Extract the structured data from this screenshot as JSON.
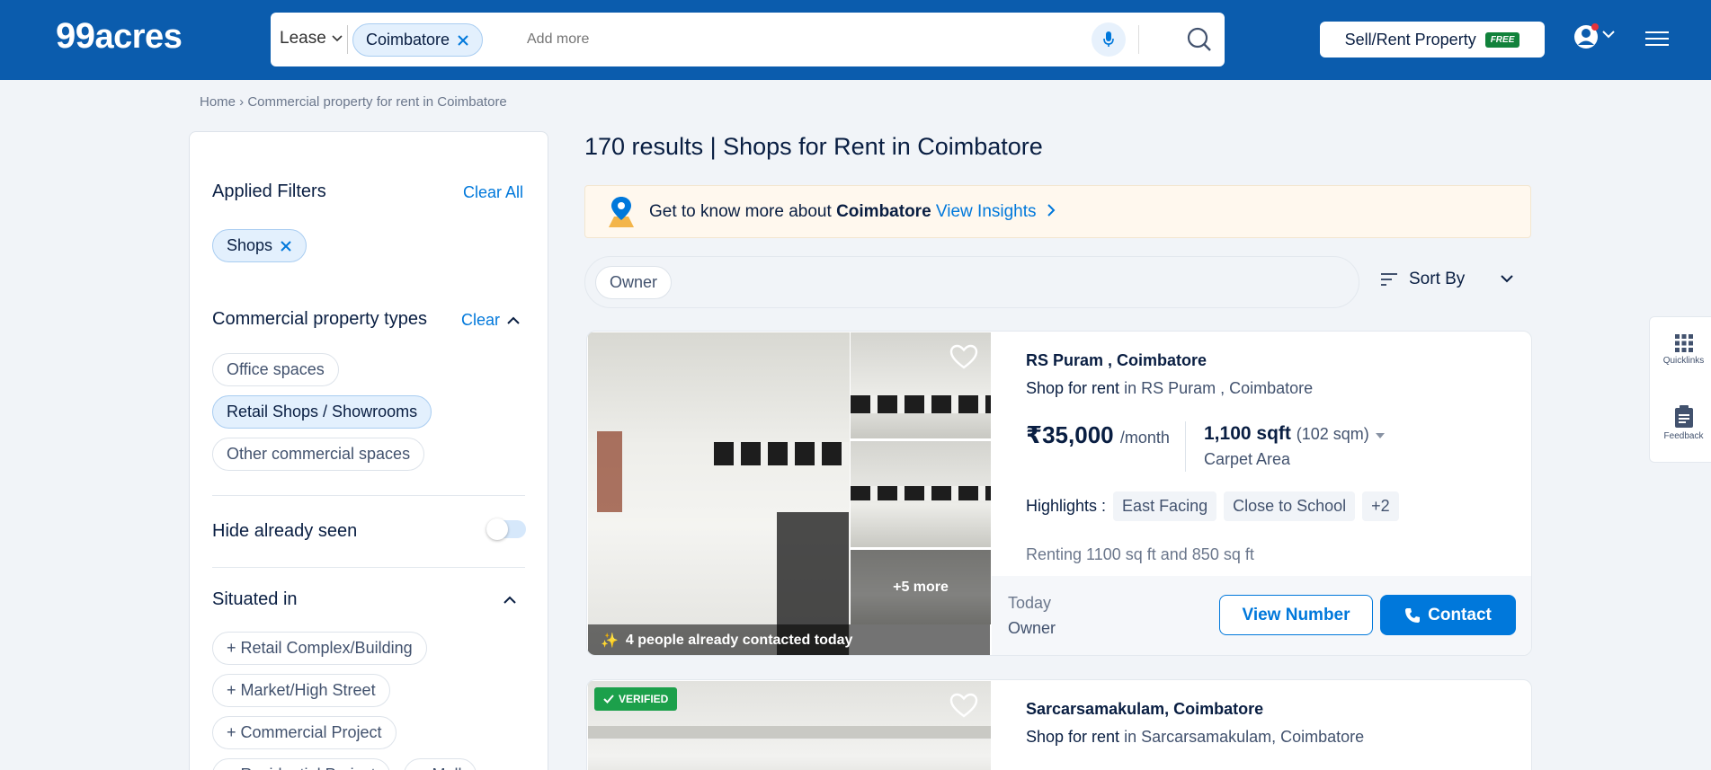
{
  "header": {
    "logo_num": "99",
    "logo_text": "acres",
    "search": {
      "mode": "Lease",
      "city_chip": "Coimbatore",
      "placeholder": "Add more"
    },
    "sell_button": "Sell/Rent Property",
    "free_badge": "FREE",
    "colors": {
      "header_bg": "#0b5cad",
      "accent": "#0078db"
    }
  },
  "breadcrumb": "Home › Commercial property for rent in Coimbatore",
  "sidebar": {
    "applied_filters": {
      "title": "Applied Filters",
      "clear_all": "Clear All",
      "chips": [
        "Shops"
      ]
    },
    "property_types": {
      "title": "Commercial property types",
      "clear": "Clear",
      "options": [
        {
          "label": "Office spaces",
          "selected": false
        },
        {
          "label": "Retail Shops / Showrooms",
          "selected": true
        },
        {
          "label": "Other commercial spaces",
          "selected": false
        }
      ]
    },
    "hide_seen": {
      "label": "Hide already seen",
      "enabled": false
    },
    "situated_in": {
      "title": "Situated in",
      "options": [
        "+ Retail Complex/Building",
        "+ Market/High Street",
        "+ Commercial Project",
        "+ Residential Project",
        "+ Mall"
      ]
    }
  },
  "main": {
    "results_title": "170 results | Shops for Rent in Coimbatore",
    "insights": {
      "prefix": "Get to know more about",
      "city": "Coimbatore",
      "link": "View Insights"
    },
    "filters": {
      "owner_chip": "Owner"
    },
    "sort_label": "Sort By",
    "listings": [
      {
        "location": "RS Puram , Coimbatore",
        "type": "Shop for rent",
        "in_text": "in RS Puram , Coimbatore",
        "price": "₹35,000",
        "price_unit": "/month",
        "area": "1,100 sqft",
        "area_sqm": "(102 sqm)",
        "area_label": "Carpet Area",
        "highlights_label": "Highlights :",
        "highlights": [
          "East Facing",
          "Close to School",
          "+2"
        ],
        "description": "Renting 1100 sq ft and 850 sq ft",
        "contacted": "4 people already contacted today",
        "more_photos": "+5 more",
        "posted": "Today",
        "posted_by": "Owner",
        "view_number": "View Number",
        "contact": "Contact"
      },
      {
        "location": "Sarcarsamakulam, Coimbatore",
        "type": "Shop for rent",
        "in_text": "in Sarcarsamakulam, Coimbatore",
        "verified": "VERIFIED"
      }
    ]
  },
  "floating": {
    "quicklinks": "Quicklinks",
    "feedback": "Feedback"
  }
}
